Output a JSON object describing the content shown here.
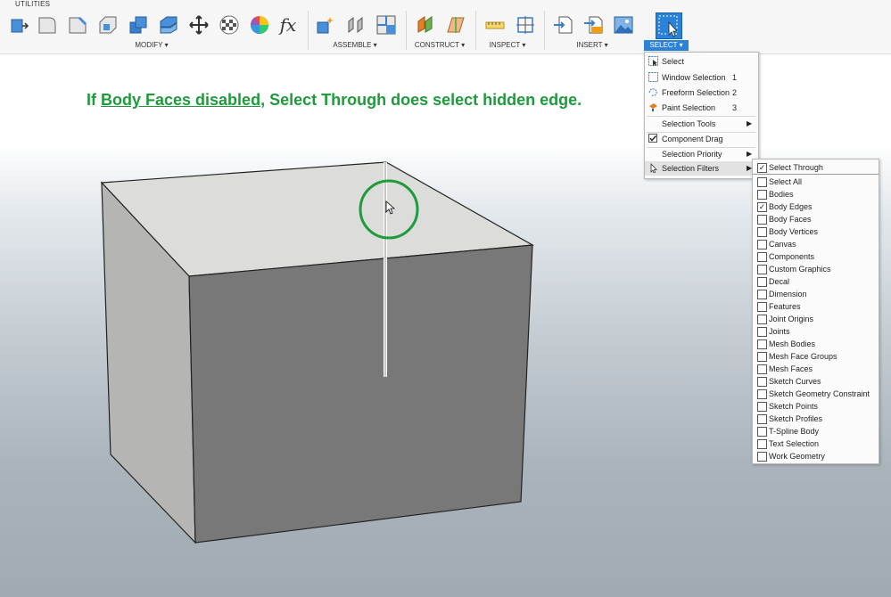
{
  "toolbar": {
    "tab_label": "UTILITIES",
    "groups": {
      "modify": "MODIFY ▾",
      "assemble": "ASSEMBLE ▾",
      "construct": "CONSTRUCT ▾",
      "inspect": "INSPECT ▾",
      "insert": "INSERT ▾",
      "select": "SELECT ▾"
    },
    "fx_label": "fx"
  },
  "annotation": {
    "prefix": "If ",
    "underlined": "Body Faces disabled",
    "suffix": ", Select Through does select hidden edge."
  },
  "colors": {
    "annotation_green": "#1f9a3c",
    "select_blue": "#2b83d8",
    "cube_top": "#dcdcda",
    "cube_left": "#b5b5b3",
    "cube_front": "#787878"
  },
  "select_menu": {
    "items": [
      {
        "label": "Select",
        "key": "",
        "icon": "select-box-icon"
      },
      {
        "label": "Window Selection",
        "key": "1",
        "icon": "window-selection-icon"
      },
      {
        "label": "Freeform Selection",
        "key": "2",
        "icon": "freeform-selection-icon"
      },
      {
        "label": "Paint Selection",
        "key": "3",
        "icon": "paint-selection-icon"
      },
      {
        "label": "Selection Tools",
        "key": "",
        "arrow": "▶"
      },
      {
        "label": "Component Drag",
        "key": "",
        "checked": true
      },
      {
        "label": "Selection Priority",
        "key": "",
        "arrow": "▶"
      },
      {
        "label": "Selection Filters",
        "key": "",
        "arrow": "▶",
        "highlighted": true
      }
    ]
  },
  "filters": {
    "items": [
      {
        "label": "Select Through",
        "checked": true
      },
      {
        "label": "Select All",
        "checked": false
      },
      {
        "label": "Bodies",
        "checked": false
      },
      {
        "label": "Body Edges",
        "checked": true
      },
      {
        "label": "Body Faces",
        "checked": false
      },
      {
        "label": "Body Vertices",
        "checked": false
      },
      {
        "label": "Canvas",
        "checked": false
      },
      {
        "label": "Components",
        "checked": false
      },
      {
        "label": "Custom Graphics",
        "checked": false
      },
      {
        "label": "Decal",
        "checked": false
      },
      {
        "label": "Dimension",
        "checked": false
      },
      {
        "label": "Features",
        "checked": false
      },
      {
        "label": "Joint Origins",
        "checked": false
      },
      {
        "label": "Joints",
        "checked": false
      },
      {
        "label": "Mesh Bodies",
        "checked": false
      },
      {
        "label": "Mesh Face Groups",
        "checked": false
      },
      {
        "label": "Mesh Faces",
        "checked": false
      },
      {
        "label": "Sketch Curves",
        "checked": false
      },
      {
        "label": "Sketch Geometry Constraint",
        "checked": false
      },
      {
        "label": "Sketch Points",
        "checked": false
      },
      {
        "label": "Sketch Profiles",
        "checked": false
      },
      {
        "label": "T-Spline Body",
        "checked": false
      },
      {
        "label": "Text Selection",
        "checked": false
      },
      {
        "label": "Work Geometry",
        "checked": false
      }
    ]
  }
}
